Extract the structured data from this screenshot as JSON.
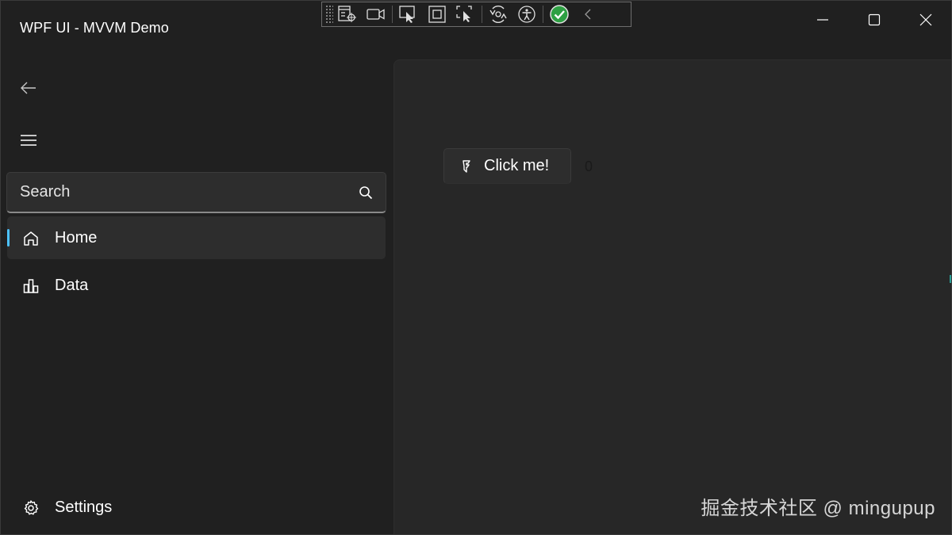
{
  "window": {
    "title": "WPF UI - MVVM Demo",
    "controls": [
      "minimize-icon",
      "maximize-icon",
      "close-icon"
    ]
  },
  "debug_toolbar": {
    "icons": [
      "live-visual-tree-icon",
      "record-video-icon",
      "select-element-icon",
      "display-layout-adorners-icon",
      "track-focus-icon",
      "hot-reload-icon",
      "accessibility-icon",
      "binding-check-icon",
      "collapse-chevron-icon"
    ],
    "check_color": "#2ea043"
  },
  "navigation": {
    "back_icon": "arrow-left-icon",
    "toggle_icon": "hamburger-icon",
    "search": {
      "placeholder": "Search",
      "value": "",
      "icon": "search-icon"
    },
    "items": [
      {
        "label": "Home",
        "icon": "home-icon",
        "active": true
      },
      {
        "label": "Data",
        "icon": "bar-chart-icon",
        "active": false
      }
    ],
    "footer_items": [
      {
        "label": "Settings",
        "icon": "gear-icon"
      }
    ],
    "accent_color": "#4cc2ff"
  },
  "content": {
    "button": {
      "label": "Click me!",
      "icon": "fluent-logo-icon"
    },
    "counter": "0"
  },
  "watermark": "掘金技术社区 @ mingupup"
}
